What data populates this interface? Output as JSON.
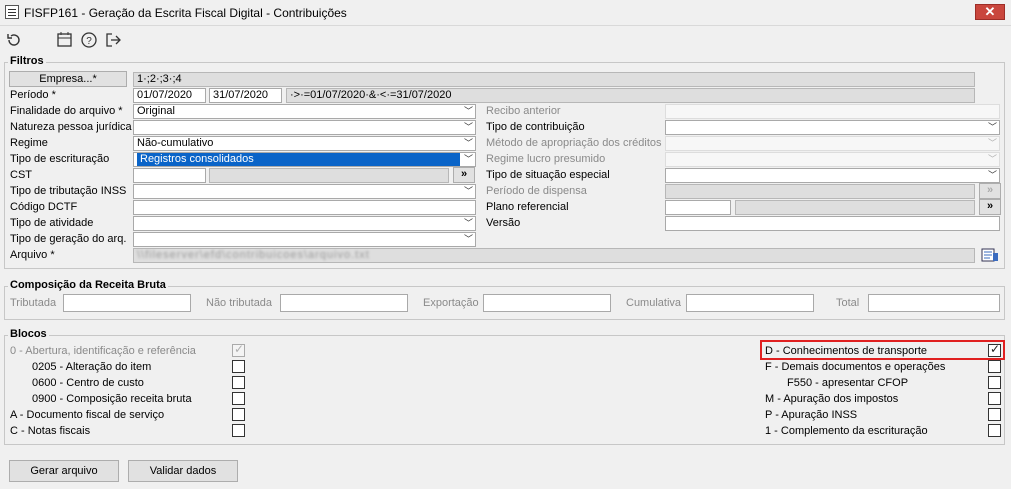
{
  "window": {
    "title": "FISFP161 - Geração da Escrita Fiscal Digital - Contribuições",
    "close": "✕"
  },
  "toolbar": {
    "icons": [
      "undo-icon",
      "calendar-icon",
      "help-icon",
      "exit-icon"
    ]
  },
  "filtros": {
    "legend": "Filtros",
    "empresa_button": "Empresa...*",
    "empresa_value": "1·;2·;3·;4",
    "periodo_label": "Período *",
    "periodo_start": "01/07/2020",
    "periodo_end": "31/07/2020",
    "periodo_expr": "·>·=01/07/2020·&·<·=31/07/2020",
    "finalidade_label": "Finalidade do arquivo *",
    "finalidade_value": "Original",
    "natureza_label": "Natureza pessoa jurídica",
    "regime_label": "Regime",
    "regime_value": "Não-cumulativo",
    "tipo_escrituracao_label": "Tipo de escrituração",
    "tipo_escrituracao_value": "Registros consolidados",
    "cst_label": "CST",
    "tipo_tributacao_label": "Tipo de tributação INSS",
    "codigo_dctf_label": "Código DCTF",
    "tipo_atividade_label": "Tipo de atividade",
    "tipo_geracao_label": "Tipo de geração do arq.",
    "arquivo_label": "Arquivo *",
    "arquivo_value": "\\\\fileserver\\efd\\contribuicoes\\arquivo.txt",
    "recibo_label": "Recibo anterior",
    "tipo_contribuicao_label": "Tipo de contribuição",
    "metodo_label": "Método de apropriação dos créditos",
    "regime_lucro_label": "Regime lucro presumido",
    "tipo_situacao_label": "Tipo de situação especial",
    "periodo_dispensa_label": "Período de dispensa",
    "plano_label": "Plano referencial",
    "versao_label": "Versão",
    "arrow_button": "»"
  },
  "composicao": {
    "legend": "Composição da Receita Bruta",
    "tributada": "Tributada",
    "nao_tributada": "Não tributada",
    "exportacao": "Exportação",
    "cumulativa": "Cumulativa",
    "total": "Total"
  },
  "blocos": {
    "legend": "Blocos",
    "left": [
      {
        "label": "0 - Abertura, identificação e referência",
        "checked": true,
        "disabled": true
      },
      {
        "label": "0205 - Alteração do item",
        "checked": false
      },
      {
        "label": "0600 - Centro de custo",
        "checked": false
      },
      {
        "label": "0900 - Composição receita bruta",
        "checked": false
      },
      {
        "label": "A - Documento fiscal de serviço",
        "checked": false
      },
      {
        "label": "C - Notas fiscais",
        "checked": false
      }
    ],
    "right": [
      {
        "label": "D - Conhecimentos de transporte",
        "checked": true,
        "highlighted": true
      },
      {
        "label": "F - Demais documentos e operações",
        "checked": false
      },
      {
        "label": "F550 - apresentar CFOP",
        "checked": false
      },
      {
        "label": "M - Apuração dos impostos",
        "checked": false
      },
      {
        "label": "P - Apuração INSS",
        "checked": false
      },
      {
        "label": "1 - Complemento da escrituração",
        "checked": false
      }
    ]
  },
  "buttons": {
    "gerar": "Gerar arquivo",
    "validar": "Validar dados"
  }
}
